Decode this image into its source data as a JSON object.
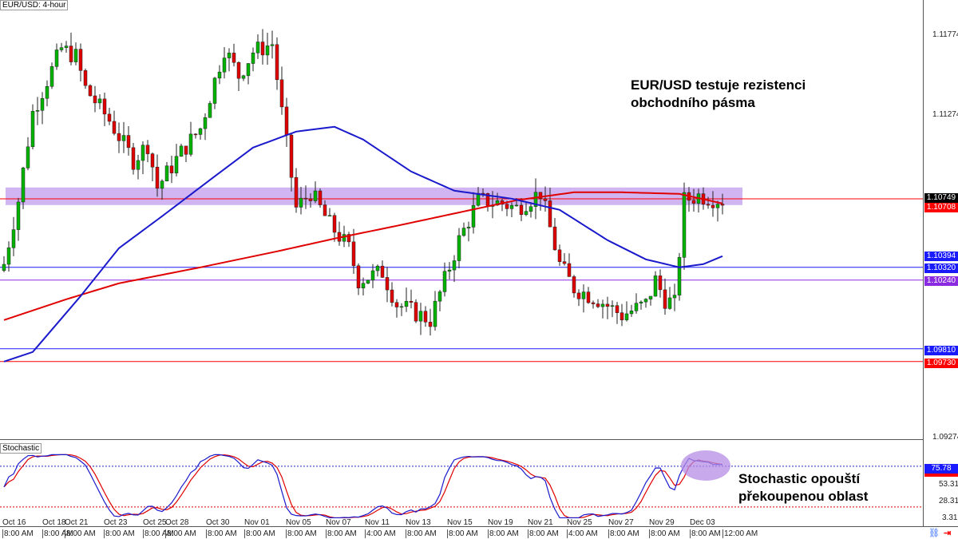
{
  "header": {
    "title": "EUR/USD: 4-hour",
    "stoch_title": "Stochastic"
  },
  "annotations": {
    "main": [
      "EUR/USD testuje rezistenci",
      "obchodního pásma"
    ],
    "stoch": [
      "Stochastic opouští",
      "překoupenou oblast"
    ]
  },
  "price_axis": {
    "ticks": [
      "1.11774",
      "1.11274",
      "1.09274"
    ],
    "tags": [
      {
        "text": "1.10749",
        "color": "#000000"
      },
      {
        "text": "1.10708",
        "color": "#ff0000"
      },
      {
        "text": "1.10394",
        "color": "#1a1aff"
      },
      {
        "text": "1.10320",
        "color": "#1a1aff"
      },
      {
        "text": "1.10240",
        "color": "#8a2be2"
      },
      {
        "text": "1.09810",
        "color": "#1a1aff"
      },
      {
        "text": "1.09730",
        "color": "#ff0000"
      }
    ]
  },
  "stoch_axis": {
    "ticks": [
      "53.31",
      "28.31",
      "3.31"
    ],
    "tag": "75.78"
  },
  "time_axis": {
    "dates": [
      "Oct 16",
      "Oct 18",
      "Oct 21",
      "Oct 23",
      "Oct 25",
      "Oct 28",
      "Oct 30",
      "Nov 01",
      "Nov 05",
      "Nov 07",
      "Nov 11",
      "Nov 13",
      "Nov 15",
      "Nov 19",
      "Nov 21",
      "Nov 25",
      "Nov 27",
      "Nov 29",
      "Dec 03"
    ],
    "times": [
      "8:00 AM",
      "8:00 AM",
      "8:00 AM",
      "8:00 AM",
      "8:00 AM",
      "8:00 AM",
      "8:00 AM",
      "8:00 AM",
      "8:00 AM",
      "8:00 AM",
      "4:00 AM",
      "8:00 AM",
      "8:00 AM",
      "8:00 AM",
      "8:00 AM",
      "4:00 AM",
      "8:00 AM",
      "8:00 AM",
      "8:00 AM",
      "12:00 AM"
    ]
  },
  "chart_data": {
    "type": "candlestick",
    "title": "EUR/USD: 4-hour",
    "ylim": [
      1.0915,
      1.1198
    ],
    "close_anchors": [
      [
        0,
        1.1034
      ],
      [
        3,
        1.1074
      ],
      [
        6,
        1.1129
      ],
      [
        12,
        1.1169
      ],
      [
        15,
        1.1164
      ],
      [
        17,
        1.1144
      ],
      [
        22,
        1.1124
      ],
      [
        27,
        1.1099
      ],
      [
        30,
        1.1109
      ],
      [
        32,
        1.1082
      ],
      [
        37,
        1.1104
      ],
      [
        41,
        1.1119
      ],
      [
        46,
        1.1169
      ],
      [
        49,
        1.1152
      ],
      [
        52,
        1.1167
      ],
      [
        56,
        1.1172
      ],
      [
        58,
        1.1129
      ],
      [
        61,
        1.1069
      ],
      [
        64,
        1.1079
      ],
      [
        68,
        1.1059
      ],
      [
        72,
        1.1044
      ],
      [
        74,
        1.1024
      ],
      [
        79,
        1.1029
      ],
      [
        82,
        1.1009
      ],
      [
        89,
        1.0999
      ],
      [
        92,
        1.1024
      ],
      [
        95,
        1.1049
      ],
      [
        99,
        1.1074
      ],
      [
        104,
        1.1072
      ],
      [
        107,
        1.1069
      ],
      [
        112,
        1.1079
      ],
      [
        116,
        1.1034
      ],
      [
        119,
        1.1019
      ],
      [
        124,
        1.1012
      ],
      [
        129,
        1.1002
      ],
      [
        134,
        1.1009
      ],
      [
        136,
        1.1024
      ],
      [
        138,
        1.1012
      ],
      [
        140,
        1.1009
      ],
      [
        142,
        1.1074
      ],
      [
        145,
        1.1077
      ],
      [
        150,
        1.1074
      ]
    ],
    "ma_blue": [
      [
        0,
        1.0973
      ],
      [
        6,
        1.0979
      ],
      [
        16,
        1.1014
      ],
      [
        24,
        1.1044
      ],
      [
        33,
        1.1064
      ],
      [
        44,
        1.1089
      ],
      [
        52,
        1.1107
      ],
      [
        61,
        1.1117
      ],
      [
        69,
        1.112
      ],
      [
        75,
        1.1112
      ],
      [
        85,
        1.1092
      ],
      [
        94,
        1.108
      ],
      [
        106,
        1.1075
      ],
      [
        116,
        1.1068
      ],
      [
        126,
        1.1049
      ],
      [
        134,
        1.1037
      ],
      [
        141,
        1.1032
      ],
      [
        146,
        1.1034
      ],
      [
        150,
        1.1039
      ]
    ],
    "ma_red": [
      [
        0,
        1.0999
      ],
      [
        13,
        1.1012
      ],
      [
        24,
        1.1022
      ],
      [
        41,
        1.1032
      ],
      [
        57,
        1.1042
      ],
      [
        69,
        1.105
      ],
      [
        82,
        1.1058
      ],
      [
        96,
        1.1067
      ],
      [
        107,
        1.1074
      ],
      [
        119,
        1.1079
      ],
      [
        129,
        1.1079
      ],
      [
        141,
        1.1078
      ],
      [
        150,
        1.1072
      ]
    ],
    "levels": [
      {
        "price": 1.10749,
        "color": "#ff0000"
      },
      {
        "price": 1.1032,
        "color": "#1a1aff"
      },
      {
        "price": 1.1024,
        "color": "#8a2be2"
      },
      {
        "price": 1.0981,
        "color": "#1a1aff"
      },
      {
        "price": 1.0973,
        "color": "#ff0000"
      }
    ],
    "zone": [
      1.1071,
      1.1082
    ],
    "stoch_levels": [
      80,
      20
    ]
  }
}
